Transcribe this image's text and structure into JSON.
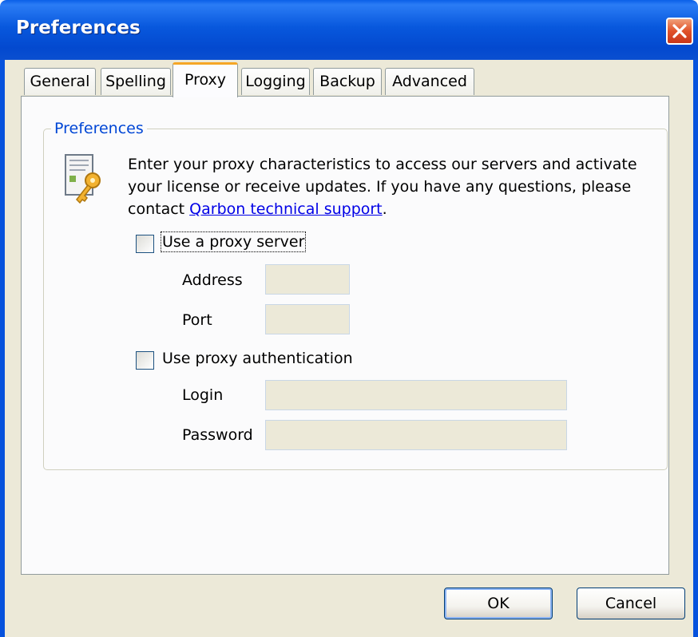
{
  "window": {
    "title": "Preferences",
    "close_icon": "close-icon"
  },
  "tabs": [
    {
      "label": "General",
      "active": false
    },
    {
      "label": "Spelling",
      "active": false
    },
    {
      "label": "Proxy",
      "active": true
    },
    {
      "label": "Logging",
      "active": false
    },
    {
      "label": "Backup",
      "active": false
    },
    {
      "label": "Advanced",
      "active": false
    }
  ],
  "group": {
    "label": "Preferences",
    "icon": "proxy-key-icon",
    "description": "Enter your proxy characteristics to access our servers and activate your license or receive updates. If you have any questions, please contact ",
    "link_text": "Qarbon technical support",
    "description_end": "."
  },
  "proxy": {
    "use_proxy_label": "Use a proxy server",
    "use_proxy_checked": false,
    "address_label": "Address",
    "address_value": "",
    "port_label": "Port",
    "port_value": ""
  },
  "auth": {
    "use_auth_label": "Use proxy authentication",
    "use_auth_checked": false,
    "login_label": "Login",
    "login_value": "",
    "password_label": "Password",
    "password_value": ""
  },
  "buttons": {
    "ok": "OK",
    "cancel": "Cancel"
  },
  "colors": {
    "titlebar": "#0A5FE8",
    "dialog_bg": "#ECE9D8",
    "group_label": "#0046D5",
    "link": "#0000E6",
    "active_tab_accent": "#F5A626"
  }
}
